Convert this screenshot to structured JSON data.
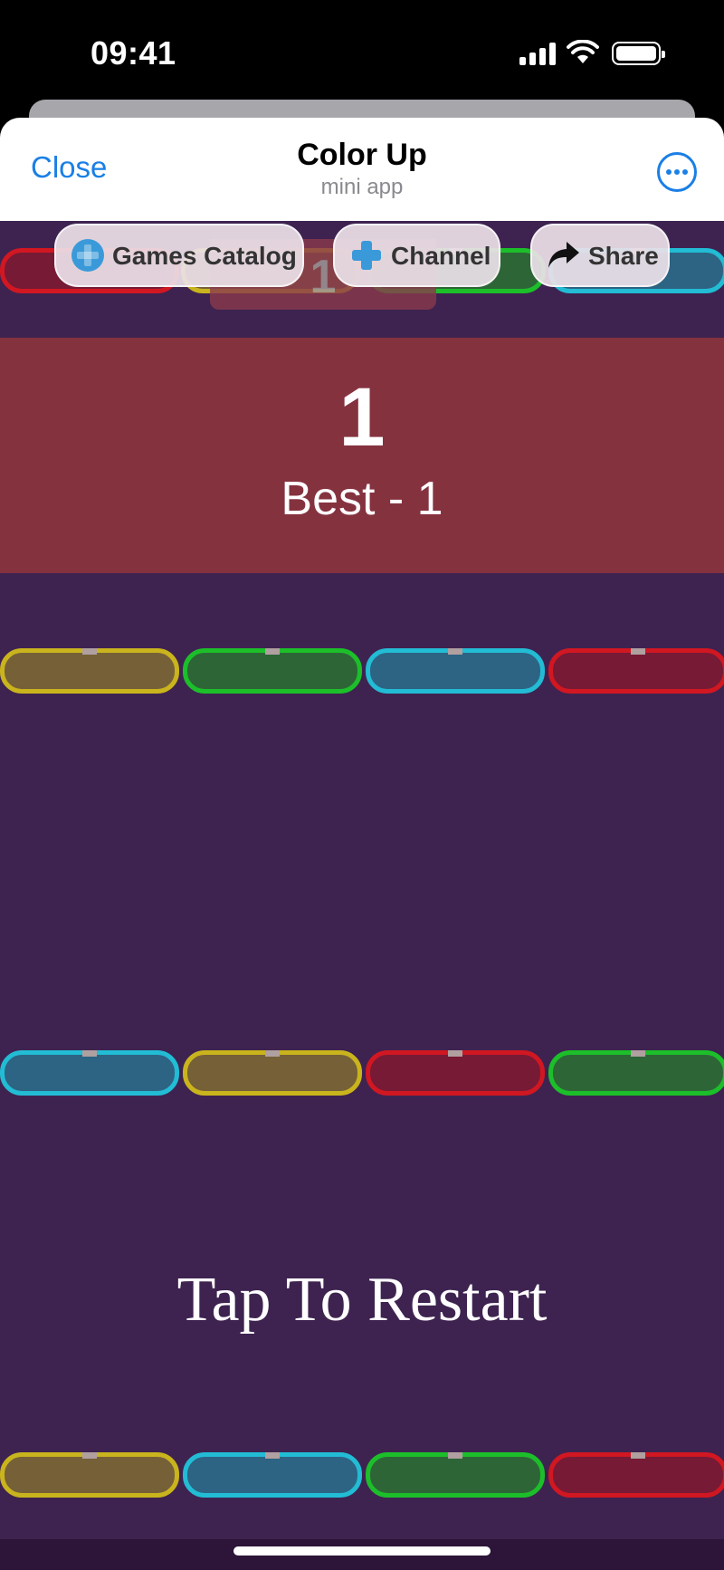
{
  "status_bar": {
    "time": "09:41"
  },
  "header": {
    "close_label": "Close",
    "title": "Color Up",
    "subtitle": "mini app"
  },
  "toolbar": {
    "games_catalog_label": "Games Catalog",
    "channel_label": "Channel",
    "share_label": "Share"
  },
  "game": {
    "small_score": "1",
    "score": "1",
    "best": "Best - 1",
    "restart": "Tap To Restart",
    "bar_colors": {
      "yellow": {
        "fill": "#766038",
        "border": "#c9b41d"
      },
      "green": {
        "fill": "#2e6537",
        "border": "#1cbf2a"
      },
      "cyan": {
        "fill": "#2d6383",
        "border": "#22bcd4"
      },
      "red": {
        "fill": "#761a35",
        "border": "#d11722"
      }
    },
    "rows": [
      [
        "yellow",
        "green",
        "cyan",
        "red"
      ],
      [
        "cyan",
        "yellow",
        "red",
        "green"
      ],
      [
        "yellow",
        "cyan",
        "green",
        "red"
      ]
    ]
  }
}
